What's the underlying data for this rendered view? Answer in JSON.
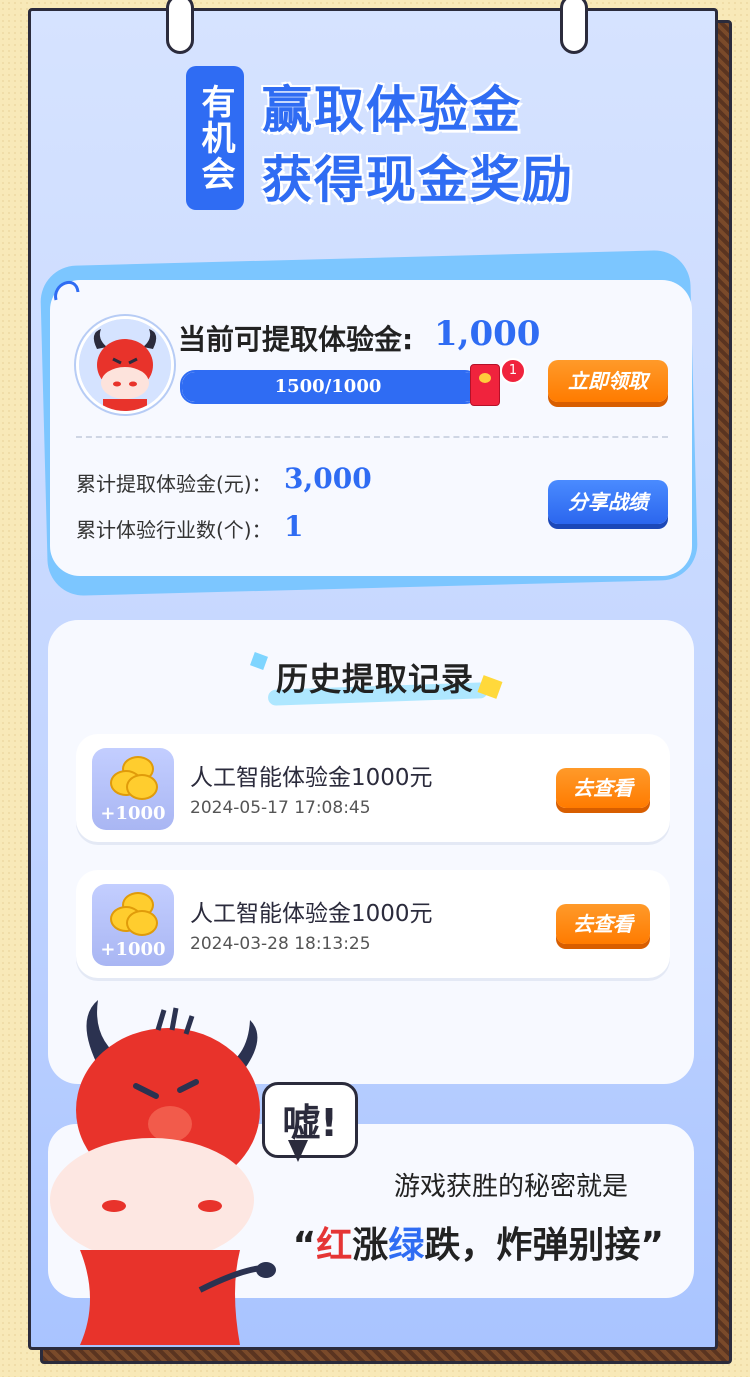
{
  "header": {
    "badge": "有机会",
    "line1": "赢取体验金",
    "line2": "获得现金奖励"
  },
  "summary": {
    "current_label": "当前可提取体验金:",
    "current_value": "1,000",
    "progress_text": "1500/1000",
    "progress_fraction": 1.0,
    "redpacket_badge": "1",
    "claim_button": "立即领取",
    "total_label": "累计提取体验金(元)：",
    "total_value": "3,000",
    "industries_label": "累计体验行业数(个)：",
    "industries_value": "1",
    "share_button": "分享战绩"
  },
  "history": {
    "title": "历史提取记录",
    "records": [
      {
        "coin_text": "+1000",
        "title": "人工智能体验金1000元",
        "time": "2024-05-17 17:08:45",
        "button": "去查看"
      },
      {
        "coin_text": "+1000",
        "title": "人工智能体验金1000元",
        "time": "2024-03-28 18:13:25",
        "button": "去查看"
      }
    ]
  },
  "tip": {
    "bubble": "嘘!",
    "secret": "游戏获胜的秘密就是",
    "open_quote": "“",
    "red_word": "红",
    "part2": "涨",
    "green_word": "绿",
    "part3": "跌，炸弹别接",
    "close_quote": "”"
  },
  "colors": {
    "accent_blue": "#2f6cf3",
    "orange": "#ff8a12",
    "red": "#e53535"
  }
}
